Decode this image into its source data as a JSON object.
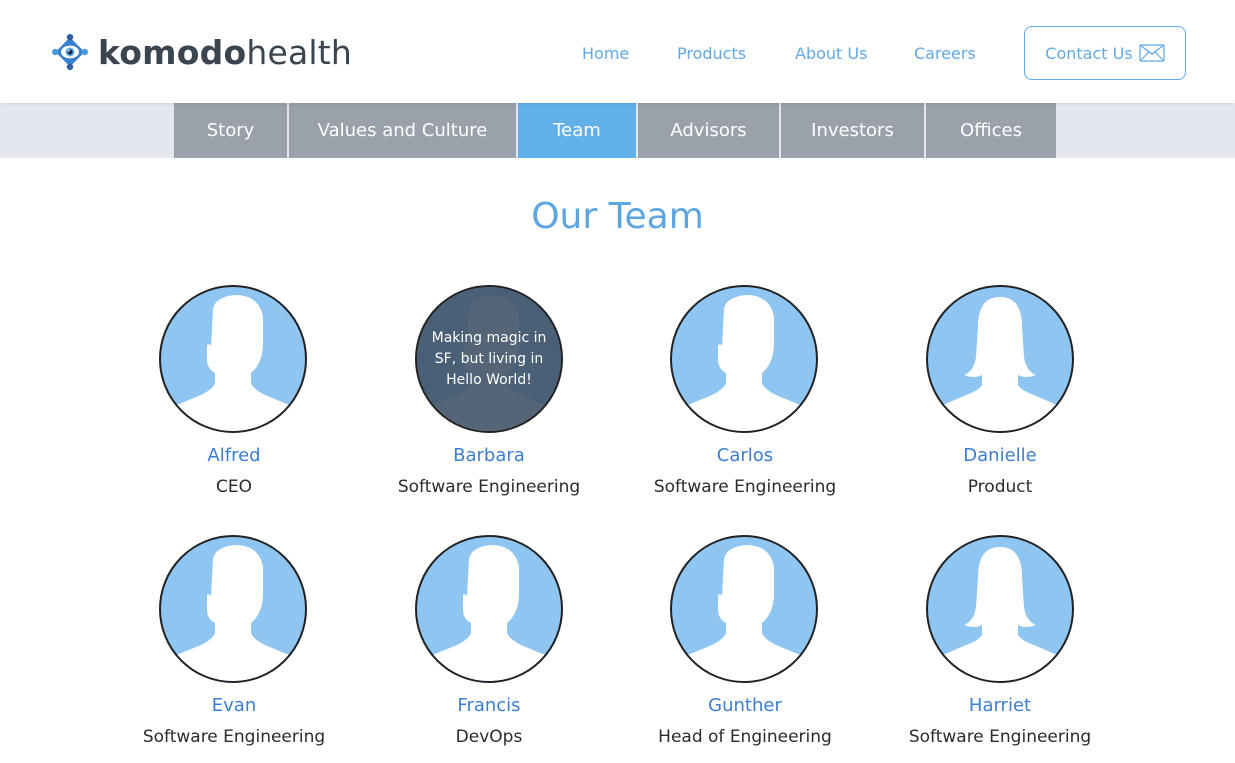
{
  "brand": {
    "name_bold": "komodo",
    "name_light": "health"
  },
  "nav": {
    "items": [
      {
        "label": "Home"
      },
      {
        "label": "Products"
      },
      {
        "label": "About Us"
      },
      {
        "label": "Careers"
      }
    ],
    "contact_label": "Contact Us",
    "contact_icon": "envelope-icon"
  },
  "subnav": {
    "tabs": [
      {
        "label": "Story",
        "active": false
      },
      {
        "label": "Values and Culture",
        "active": false
      },
      {
        "label": "Team",
        "active": true
      },
      {
        "label": "Advisors",
        "active": false
      },
      {
        "label": "Investors",
        "active": false
      },
      {
        "label": "Offices",
        "active": false
      }
    ]
  },
  "page": {
    "title": "Our Team"
  },
  "team": {
    "members": [
      {
        "name": "Alfred",
        "role": "CEO",
        "avatar": "male-silhouette-icon"
      },
      {
        "name": "Barbara",
        "role": "Software Engineering",
        "avatar": "male-silhouette-icon",
        "hover_text": "Making magic in SF, but living in Hello World!"
      },
      {
        "name": "Carlos",
        "role": "Software Engineering",
        "avatar": "male-silhouette-icon"
      },
      {
        "name": "Danielle",
        "role": "Product",
        "avatar": "female-silhouette-icon"
      },
      {
        "name": "Evan",
        "role": "Software Engineering",
        "avatar": "male-silhouette-icon"
      },
      {
        "name": "Francis",
        "role": "DevOps",
        "avatar": "male-silhouette-icon"
      },
      {
        "name": "Gunther",
        "role": "Head of Engineering",
        "avatar": "male-silhouette-icon"
      },
      {
        "name": "Harriet",
        "role": "Software Engineering",
        "avatar": "female-silhouette-icon"
      }
    ]
  },
  "colors": {
    "accent": "#5da6e2",
    "tab_inactive": "#9aa1ab",
    "tab_active": "#62b0e8",
    "avatar_bg": "#8ec5f1",
    "name": "#3c7fcf"
  }
}
